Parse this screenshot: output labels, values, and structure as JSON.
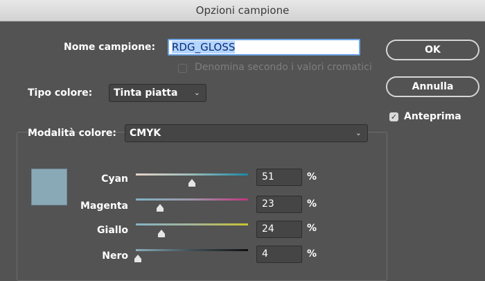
{
  "dialog": {
    "title": "Opzioni campione"
  },
  "name_field": {
    "label": "Nome campione:",
    "value": "RDG_GLOSS"
  },
  "name_by_value": {
    "label": "Denomina secondo i valori cromatici",
    "checked": false,
    "enabled": false
  },
  "color_type": {
    "label": "Tipo colore:",
    "value": "Tinta piatta"
  },
  "color_mode": {
    "label": "Modalità colore:",
    "value": "CMYK"
  },
  "buttons": {
    "ok": "OK",
    "cancel": "Annulla"
  },
  "preview": {
    "label": "Anteprima",
    "checked": true
  },
  "swatch_color": "#8aa9b7",
  "sliders": [
    {
      "label": "Cyan",
      "value": "51",
      "unit": "%"
    },
    {
      "label": "Magenta",
      "value": "23",
      "unit": "%"
    },
    {
      "label": "Giallo",
      "value": "24",
      "unit": "%"
    },
    {
      "label": "Nero",
      "value": "4",
      "unit": "%"
    }
  ],
  "icons": [
    "chevron-down-icon",
    "checkbox-checked-icon",
    "slider-handle-icon"
  ]
}
